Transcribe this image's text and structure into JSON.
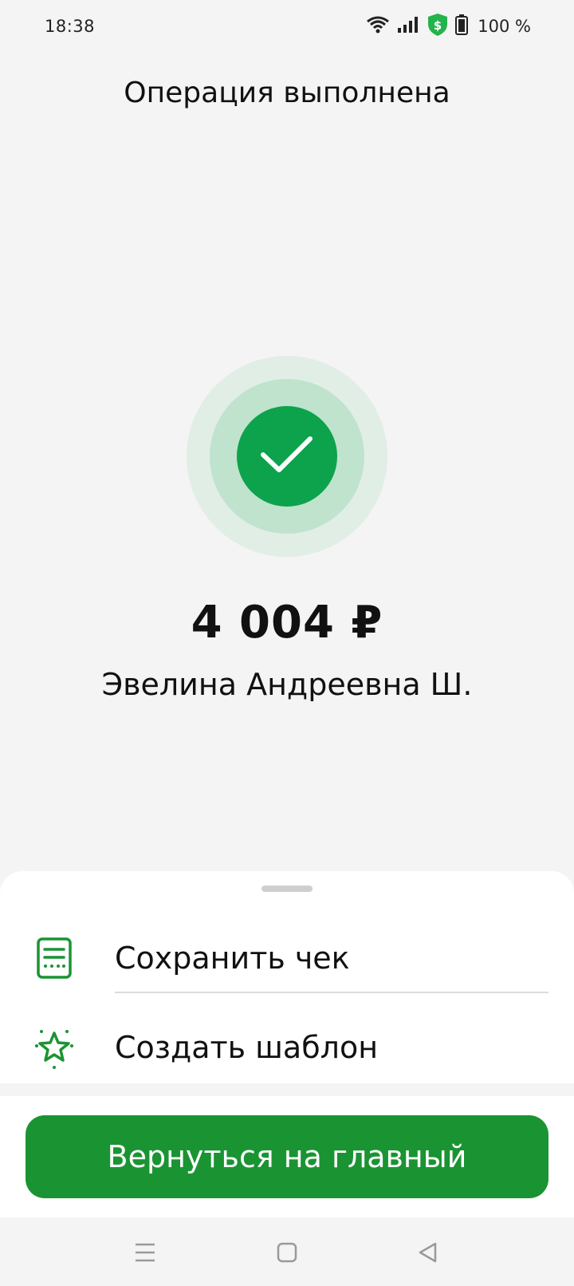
{
  "status_bar": {
    "time": "18:38",
    "battery": "100 %",
    "icons": [
      "wifi-icon",
      "signal-icon",
      "security-shield-icon",
      "battery-icon"
    ]
  },
  "header": {
    "title": "Операция выполнена"
  },
  "result": {
    "status_icon": "check-icon",
    "amount": "4 004 ₽",
    "recipient": "Эвелина Андреевна Ш."
  },
  "sheet": {
    "items": [
      {
        "label": "Сохранить чек",
        "icon": "receipt-icon"
      },
      {
        "label": "Создать шаблон",
        "icon": "star-icon"
      }
    ]
  },
  "actions": {
    "primary_label": "Вернуться на главный"
  },
  "nav": {
    "icons": [
      "menu-icon",
      "home-icon",
      "back-icon"
    ]
  },
  "colors": {
    "accent": "#1a9432",
    "success": "#0ca34c",
    "background": "#f4f4f4"
  }
}
